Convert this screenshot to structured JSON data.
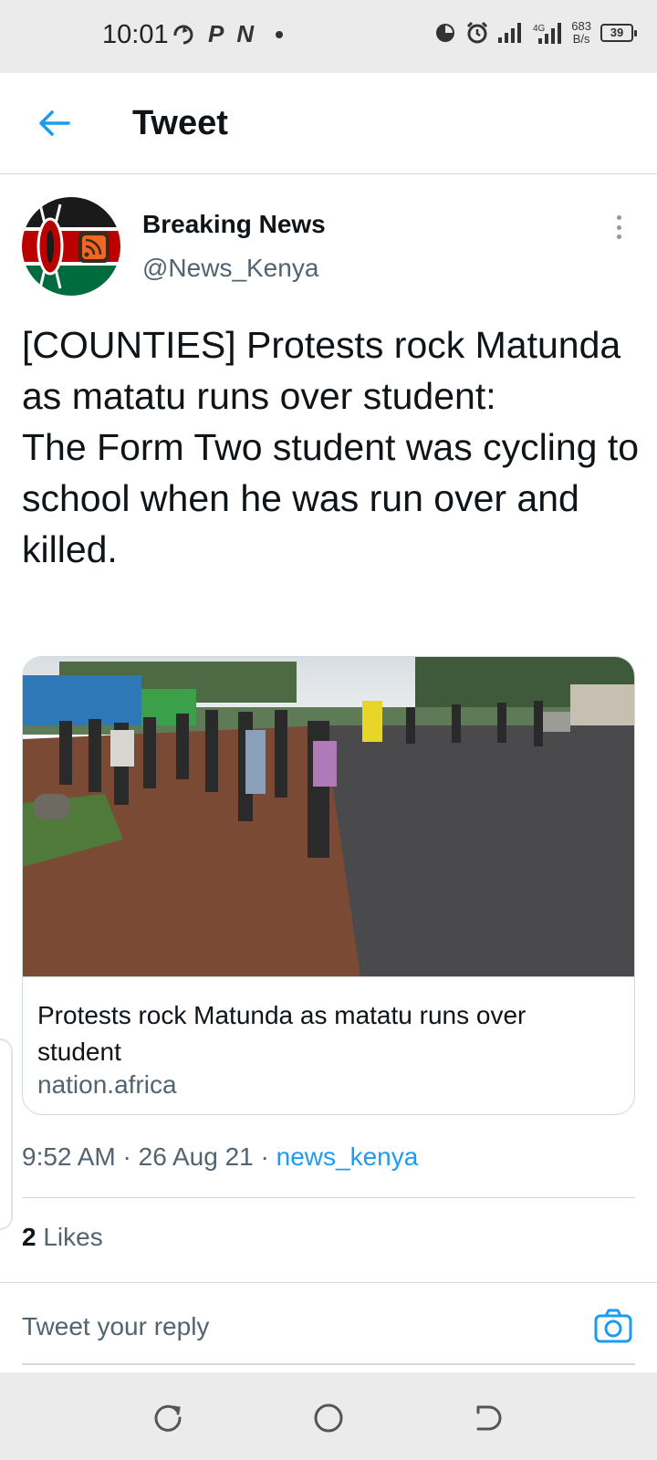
{
  "status_bar": {
    "time": "10:01",
    "icons_left": [
      "refresh-icon",
      "p-app-icon",
      "n-app-icon",
      "dot-icon"
    ],
    "icons_right": [
      "data-saver-icon",
      "alarm-icon",
      "signal-icon",
      "signal-4g-icon"
    ],
    "network_speed_value": "683",
    "network_speed_unit": "B/s",
    "battery": "39"
  },
  "header": {
    "title": "Tweet"
  },
  "tweet": {
    "author_name": "Breaking News",
    "author_handle": "@News_Kenya",
    "text": "[COUNTIES] Protests rock Matunda as matatu runs over student:\nThe Form Two student was cycling to school when he was run over and killed.",
    "card": {
      "title": "Protests rock Matunda as matatu runs over student",
      "domain": "nation.africa"
    },
    "time": "9:52 AM",
    "date": "26 Aug 21",
    "source": "news_kenya",
    "likes_count": "2",
    "likes_label": "Likes"
  },
  "reply": {
    "placeholder": "Tweet your reply"
  },
  "colors": {
    "accent": "#1d9bf0",
    "text_primary": "#0f1419",
    "text_secondary": "#536471",
    "border": "#cfd9de"
  }
}
